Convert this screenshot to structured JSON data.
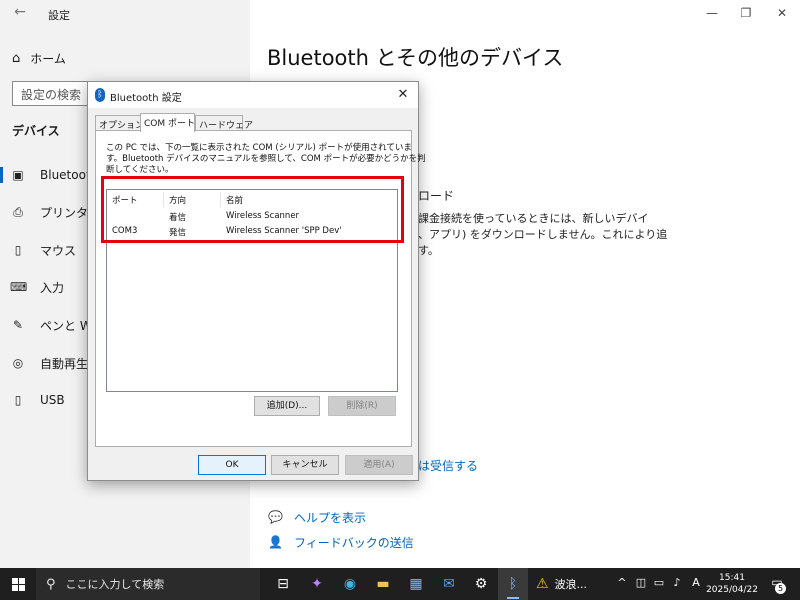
{
  "settings": {
    "app_title": "設定",
    "home_label": "ホーム",
    "search_placeholder": "設定の検索",
    "section_title": "デバイス",
    "nav": [
      {
        "label": "Bluetooth",
        "icon": "bluetooth-devices-icon"
      },
      {
        "label": "プリンターと",
        "icon": "printer-icon"
      },
      {
        "label": "マウス",
        "icon": "mouse-icon"
      },
      {
        "label": "入力",
        "icon": "keyboard-icon"
      },
      {
        "label": "ペンと Win",
        "icon": "pen-icon"
      },
      {
        "label": "自動再生",
        "icon": "autoplay-icon"
      },
      {
        "label": "USB",
        "icon": "usb-icon"
      }
    ],
    "main_title": "Bluetooth とその他のデバイス",
    "bg_snippets": {
      "download_heading": "ロード",
      "line1": "課金接続を使っているときには、新しいデバイ",
      "line2": "、アプリ) をダウンロードしません。これにより追",
      "line3": "す。"
    },
    "receive_link": "は受信する",
    "help": {
      "label": "ヘルプを表示",
      "icon": "help-chat-icon"
    },
    "feedback": {
      "label": "フィードバックの送信",
      "icon": "feedback-icon"
    }
  },
  "dialog": {
    "title": "Bluetooth 設定",
    "tabs": [
      "オプション",
      "COM ポート",
      "ハードウェア"
    ],
    "active_tab": 1,
    "description": [
      "この PC では、下の一覧に表示された COM (シリアル) ポートが使用されていま",
      "す。Bluetooth デバイスのマニュアルを参照して、COM ポートが必要かどうかを判",
      "断してください。"
    ],
    "columns": [
      "ポート",
      "方向",
      "名前"
    ],
    "rows": [
      {
        "port": "",
        "direction": "着信",
        "name": "Wireless Scanner"
      },
      {
        "port": "COM3",
        "direction": "発信",
        "name": "Wireless Scanner 'SPP Dev'"
      }
    ],
    "add_button": "追加(D)...",
    "remove_button": "削除(R)",
    "ok_button": "OK",
    "cancel_button": "キャンセル",
    "apply_button": "適用(A)"
  },
  "taskbar": {
    "search_placeholder": "ここに入力して検索",
    "weather_text": "波浪...",
    "time": "15:41",
    "date": "2025/04/22",
    "ime_label": "A",
    "notification_count": "5"
  },
  "colors": {
    "accent": "#0067c0",
    "highlight_border": "#e60012",
    "taskbar_bg": "#1f1f1f",
    "sidebar_bg": "#f2f2f2"
  }
}
